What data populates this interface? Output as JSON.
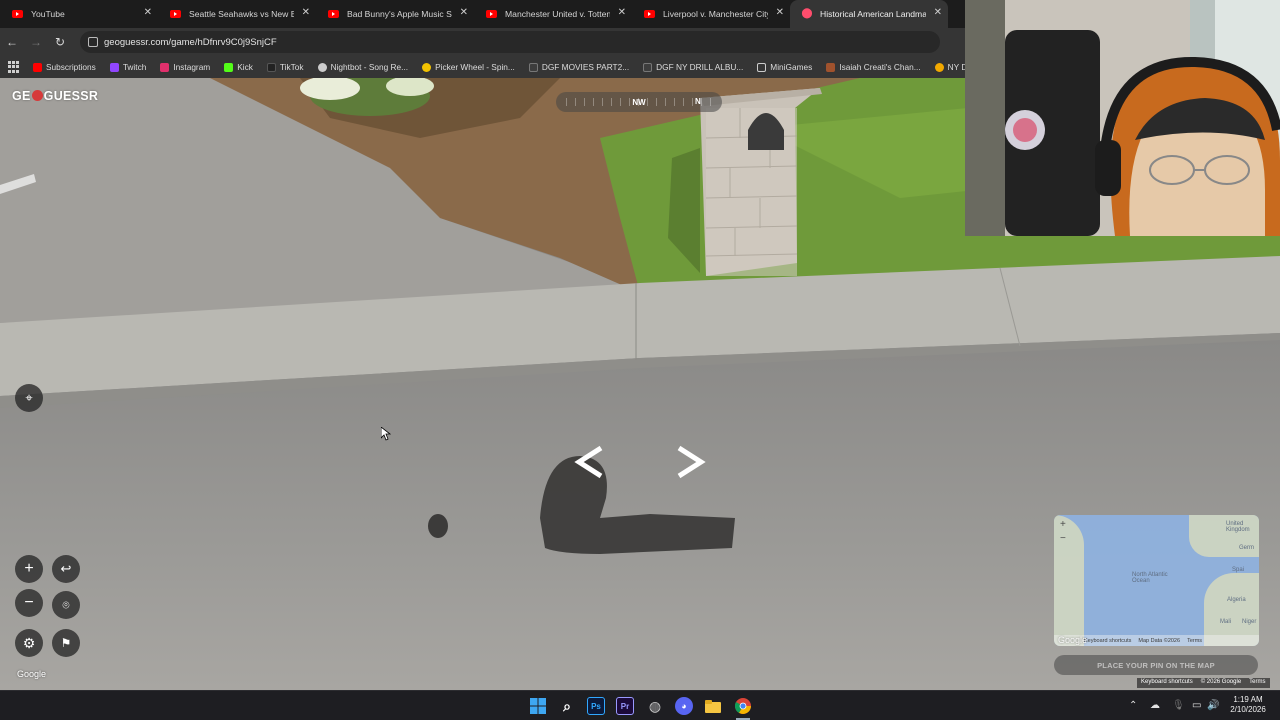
{
  "browser": {
    "tabs": [
      {
        "label": "YouTube",
        "favicon": "youtube-icon",
        "active": false
      },
      {
        "label": "Seattle Seahawks vs New Engla",
        "favicon": "youtube-icon",
        "active": false
      },
      {
        "label": "Bad Bunny's Apple Music Supe",
        "favicon": "youtube-icon",
        "active": false
      },
      {
        "label": "Manchester United v. Tottenha",
        "favicon": "youtube-icon",
        "active": false
      },
      {
        "label": "Liverpool v. Manchester City | P",
        "favicon": "youtube-icon",
        "active": false
      },
      {
        "label": "Historical American Landmarks",
        "favicon": "geoguessr-pin-icon",
        "active": true
      }
    ],
    "url": "geoguessr.com/game/hDfnrv9C0j9SnjCF",
    "bookmarks": [
      {
        "label": "Subscriptions",
        "color": "#ff0000"
      },
      {
        "label": "Twitch",
        "color": "#9146ff"
      },
      {
        "label": "Instagram",
        "color": "#e1306c"
      },
      {
        "label": "Kick",
        "color": "#53fc18"
      },
      {
        "label": "TikTok",
        "color": "#222222"
      },
      {
        "label": "Nightbot - Song Re...",
        "color": "#cccccc"
      },
      {
        "label": "Picker Wheel - Spin...",
        "color": "#f2c200"
      },
      {
        "label": "DGF MOVIES PART2...",
        "color": "#3d3d3d"
      },
      {
        "label": "DGF NY DRILL ALBU...",
        "color": "#3d3d3d"
      },
      {
        "label": "MiniGames",
        "color": "#888888"
      },
      {
        "label": "Isaiah Creati's Chan...",
        "color": "#a0522d"
      },
      {
        "label": "NY Drill Deads Q...",
        "color": "#f2a900"
      }
    ]
  },
  "game": {
    "logo_text_left": "GE",
    "logo_text_right": "GUESSR",
    "compass_heading": "NW",
    "compass_secondary": "N",
    "google_watermark": "Google",
    "minimap": {
      "labels": {
        "united_kingdom": "United Kingdom",
        "germany": "Germ",
        "north_atlantic": "North Atlantic Ocean",
        "spain": "Spai",
        "algeria": "Algeria",
        "mali": "Mali",
        "niger": "Niger"
      },
      "google": "Google",
      "shortcuts": "Keyboard shortcuts",
      "map_data": "Map Data ©2026",
      "terms": "Terms"
    },
    "place_pin_label": "PLACE YOUR PIN ON THE MAP",
    "footer": {
      "shortcuts": "Keyboard shortcuts",
      "copyright": "© 2026 Google",
      "terms": "Terms"
    }
  },
  "taskbar": {
    "time": "1:19 AM",
    "date": "2/10/2026"
  },
  "colors": {
    "accent_geoguessr": "#d63a3a",
    "road": "#8d8c8a",
    "grass": "#6f9a3a"
  }
}
